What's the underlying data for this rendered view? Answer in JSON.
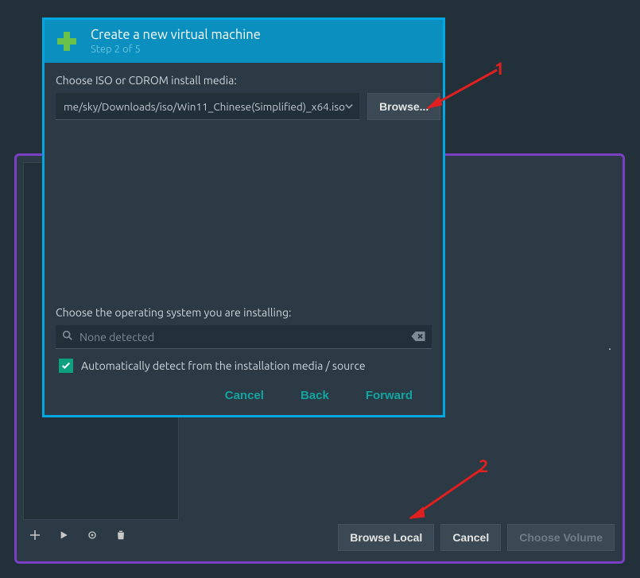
{
  "dialog": {
    "title": "Create a new virtual machine",
    "step_label": "Step 2 of 5",
    "iso_label": "Choose ISO or CDROM install media:",
    "iso_value": "me/sky/Downloads/iso/Win11_Chinese(Simplified)_x64.iso",
    "browse_label": "Browse...",
    "os_label": "Choose the operating system you are installing:",
    "os_search_placeholder": "None detected",
    "auto_detect_label": "Automatically detect from the installation media / source",
    "auto_detect_checked": true,
    "actions": {
      "cancel": "Cancel",
      "back": "Back",
      "forward": "Forward"
    }
  },
  "volume_browser": {
    "right_text": ".",
    "buttons": {
      "browse_local": "Browse Local",
      "cancel": "Cancel",
      "choose_volume": "Choose Volume"
    },
    "toolbar_icons": [
      "plus-icon",
      "play-icon",
      "refresh-icon",
      "trash-icon"
    ]
  },
  "callouts": {
    "one": "1",
    "two": "2"
  },
  "colors": {
    "accent_blue": "#00a7e0",
    "accent_purple": "#7a3fc4",
    "accent_teal": "#0fa080",
    "callout_red": "#e02020"
  }
}
